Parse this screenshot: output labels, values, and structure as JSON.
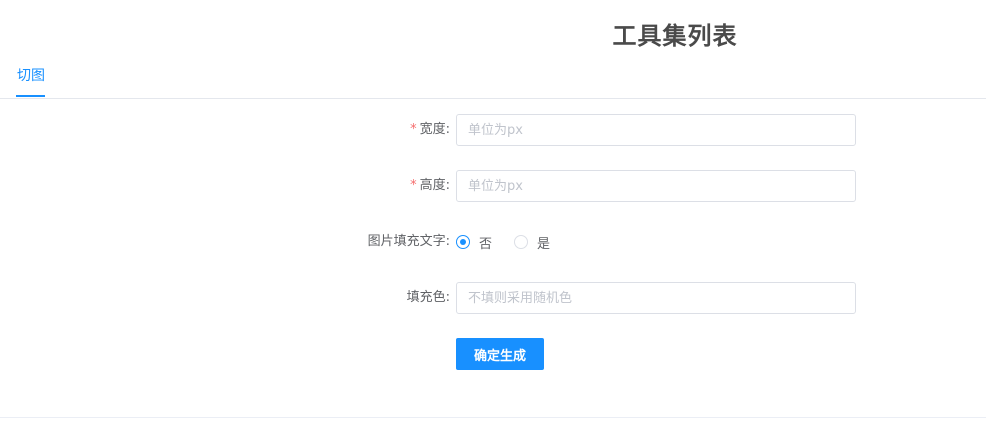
{
  "header": {
    "title": "工具集列表"
  },
  "tabs": [
    {
      "label": "切图",
      "active": true
    }
  ],
  "form": {
    "width": {
      "required_mark": "*",
      "label": "宽度:",
      "placeholder": "单位为px",
      "value": ""
    },
    "height": {
      "required_mark": "*",
      "label": "高度:",
      "placeholder": "单位为px",
      "value": ""
    },
    "fill_text": {
      "label": "图片填充文字:",
      "options": [
        {
          "label": "否",
          "selected": true
        },
        {
          "label": "是",
          "selected": false
        }
      ]
    },
    "fill_color": {
      "label": "填充色:",
      "placeholder": "不填则采用随机色",
      "value": ""
    },
    "submit_label": "确定生成"
  },
  "colors": {
    "accent": "#1890ff",
    "required": "#f56c6c",
    "border": "#dcdfe6"
  }
}
